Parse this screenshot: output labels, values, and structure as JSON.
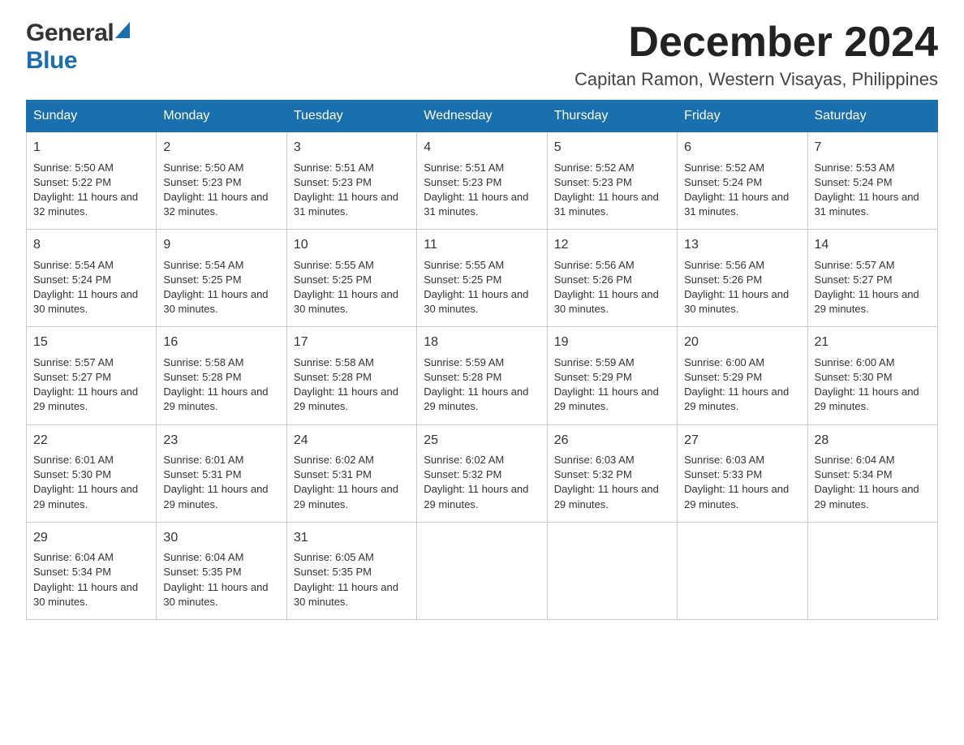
{
  "header": {
    "logo_general": "General",
    "logo_blue": "Blue",
    "month_title": "December 2024",
    "subtitle": "Capitan Ramon, Western Visayas, Philippines"
  },
  "days_of_week": [
    "Sunday",
    "Monday",
    "Tuesday",
    "Wednesday",
    "Thursday",
    "Friday",
    "Saturday"
  ],
  "weeks": [
    [
      {
        "day": "1",
        "sunrise": "5:50 AM",
        "sunset": "5:22 PM",
        "daylight": "11 hours and 32 minutes."
      },
      {
        "day": "2",
        "sunrise": "5:50 AM",
        "sunset": "5:23 PM",
        "daylight": "11 hours and 32 minutes."
      },
      {
        "day": "3",
        "sunrise": "5:51 AM",
        "sunset": "5:23 PM",
        "daylight": "11 hours and 31 minutes."
      },
      {
        "day": "4",
        "sunrise": "5:51 AM",
        "sunset": "5:23 PM",
        "daylight": "11 hours and 31 minutes."
      },
      {
        "day": "5",
        "sunrise": "5:52 AM",
        "sunset": "5:23 PM",
        "daylight": "11 hours and 31 minutes."
      },
      {
        "day": "6",
        "sunrise": "5:52 AM",
        "sunset": "5:24 PM",
        "daylight": "11 hours and 31 minutes."
      },
      {
        "day": "7",
        "sunrise": "5:53 AM",
        "sunset": "5:24 PM",
        "daylight": "11 hours and 31 minutes."
      }
    ],
    [
      {
        "day": "8",
        "sunrise": "5:54 AM",
        "sunset": "5:24 PM",
        "daylight": "11 hours and 30 minutes."
      },
      {
        "day": "9",
        "sunrise": "5:54 AM",
        "sunset": "5:25 PM",
        "daylight": "11 hours and 30 minutes."
      },
      {
        "day": "10",
        "sunrise": "5:55 AM",
        "sunset": "5:25 PM",
        "daylight": "11 hours and 30 minutes."
      },
      {
        "day": "11",
        "sunrise": "5:55 AM",
        "sunset": "5:25 PM",
        "daylight": "11 hours and 30 minutes."
      },
      {
        "day": "12",
        "sunrise": "5:56 AM",
        "sunset": "5:26 PM",
        "daylight": "11 hours and 30 minutes."
      },
      {
        "day": "13",
        "sunrise": "5:56 AM",
        "sunset": "5:26 PM",
        "daylight": "11 hours and 30 minutes."
      },
      {
        "day": "14",
        "sunrise": "5:57 AM",
        "sunset": "5:27 PM",
        "daylight": "11 hours and 29 minutes."
      }
    ],
    [
      {
        "day": "15",
        "sunrise": "5:57 AM",
        "sunset": "5:27 PM",
        "daylight": "11 hours and 29 minutes."
      },
      {
        "day": "16",
        "sunrise": "5:58 AM",
        "sunset": "5:28 PM",
        "daylight": "11 hours and 29 minutes."
      },
      {
        "day": "17",
        "sunrise": "5:58 AM",
        "sunset": "5:28 PM",
        "daylight": "11 hours and 29 minutes."
      },
      {
        "day": "18",
        "sunrise": "5:59 AM",
        "sunset": "5:28 PM",
        "daylight": "11 hours and 29 minutes."
      },
      {
        "day": "19",
        "sunrise": "5:59 AM",
        "sunset": "5:29 PM",
        "daylight": "11 hours and 29 minutes."
      },
      {
        "day": "20",
        "sunrise": "6:00 AM",
        "sunset": "5:29 PM",
        "daylight": "11 hours and 29 minutes."
      },
      {
        "day": "21",
        "sunrise": "6:00 AM",
        "sunset": "5:30 PM",
        "daylight": "11 hours and 29 minutes."
      }
    ],
    [
      {
        "day": "22",
        "sunrise": "6:01 AM",
        "sunset": "5:30 PM",
        "daylight": "11 hours and 29 minutes."
      },
      {
        "day": "23",
        "sunrise": "6:01 AM",
        "sunset": "5:31 PM",
        "daylight": "11 hours and 29 minutes."
      },
      {
        "day": "24",
        "sunrise": "6:02 AM",
        "sunset": "5:31 PM",
        "daylight": "11 hours and 29 minutes."
      },
      {
        "day": "25",
        "sunrise": "6:02 AM",
        "sunset": "5:32 PM",
        "daylight": "11 hours and 29 minutes."
      },
      {
        "day": "26",
        "sunrise": "6:03 AM",
        "sunset": "5:32 PM",
        "daylight": "11 hours and 29 minutes."
      },
      {
        "day": "27",
        "sunrise": "6:03 AM",
        "sunset": "5:33 PM",
        "daylight": "11 hours and 29 minutes."
      },
      {
        "day": "28",
        "sunrise": "6:04 AM",
        "sunset": "5:34 PM",
        "daylight": "11 hours and 29 minutes."
      }
    ],
    [
      {
        "day": "29",
        "sunrise": "6:04 AM",
        "sunset": "5:34 PM",
        "daylight": "11 hours and 30 minutes."
      },
      {
        "day": "30",
        "sunrise": "6:04 AM",
        "sunset": "5:35 PM",
        "daylight": "11 hours and 30 minutes."
      },
      {
        "day": "31",
        "sunrise": "6:05 AM",
        "sunset": "5:35 PM",
        "daylight": "11 hours and 30 minutes."
      },
      null,
      null,
      null,
      null
    ]
  ],
  "labels": {
    "sunrise": "Sunrise:",
    "sunset": "Sunset:",
    "daylight": "Daylight:"
  }
}
